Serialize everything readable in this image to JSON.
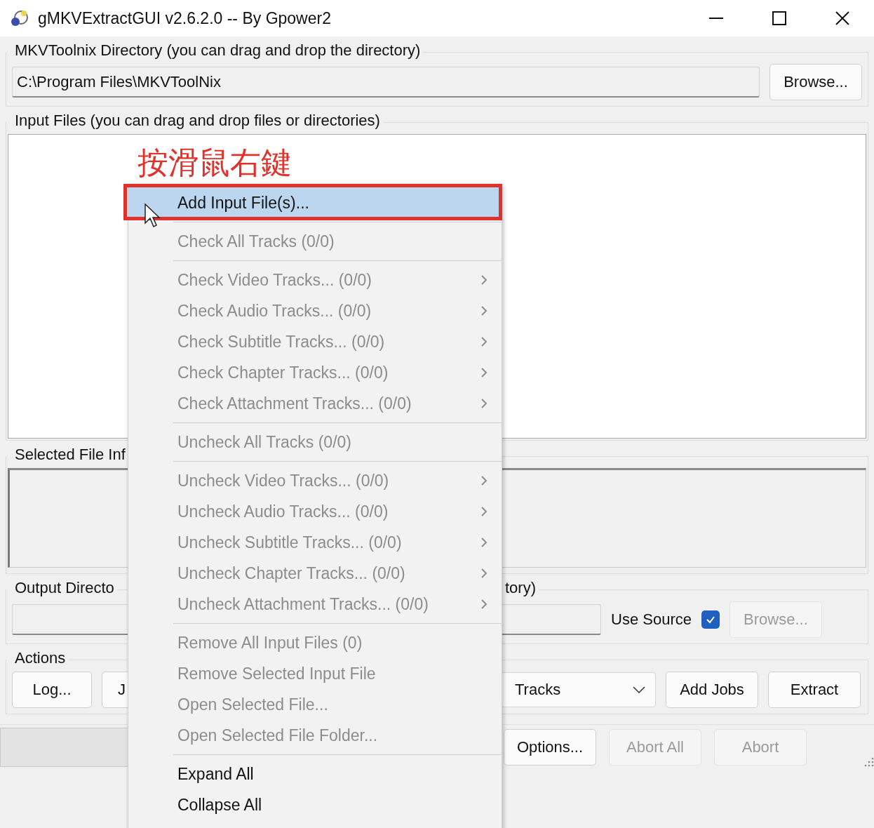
{
  "window": {
    "title": "gMKVExtractGUI v2.6.2.0 -- By Gpower2"
  },
  "mkvtoolnix_directory": {
    "label": "MKVToolnix Directory (you can drag and drop the directory)",
    "value": "C:\\Program Files\\MKVToolNix",
    "browse_button": "Browse..."
  },
  "input_files": {
    "label": "Input Files (you can drag and drop files or directories)"
  },
  "selected_file_info": {
    "label": "Selected File Inf"
  },
  "output_directory": {
    "label_left": "Output Directo",
    "label_right": "tory)",
    "use_source": {
      "label": "Use Source",
      "checked": true
    },
    "browse_button": {
      "label": "Browse...",
      "disabled": true
    }
  },
  "actions": {
    "label": "Actions",
    "log_button": "Log...",
    "jobs_button": "J",
    "mode_select": "Tracks",
    "add_jobs_button": "Add Jobs",
    "extract_button": "Extract"
  },
  "bottom_bar": {
    "options_button": {
      "label": "Options...",
      "disabled": false
    },
    "abort_all_button": {
      "label": "Abort All",
      "disabled": true
    },
    "abort_button": {
      "label": "Abort",
      "disabled": true
    }
  },
  "annotation": {
    "text": "按滑鼠右鍵"
  },
  "context_menu": {
    "groups": [
      [
        {
          "label": "Add Input File(s)...",
          "selected": true,
          "disabled": false,
          "submenu": false
        }
      ],
      [
        {
          "label": "Check All Tracks (0/0)",
          "selected": false,
          "disabled": true,
          "submenu": false
        }
      ],
      [
        {
          "label": "Check Video Tracks... (0/0)",
          "selected": false,
          "disabled": true,
          "submenu": true
        },
        {
          "label": "Check Audio Tracks... (0/0)",
          "selected": false,
          "disabled": true,
          "submenu": true
        },
        {
          "label": "Check Subtitle Tracks... (0/0)",
          "selected": false,
          "disabled": true,
          "submenu": true
        },
        {
          "label": "Check Chapter Tracks... (0/0)",
          "selected": false,
          "disabled": true,
          "submenu": true
        },
        {
          "label": "Check Attachment Tracks... (0/0)",
          "selected": false,
          "disabled": true,
          "submenu": true
        }
      ],
      [
        {
          "label": "Uncheck All Tracks (0/0)",
          "selected": false,
          "disabled": true,
          "submenu": false
        }
      ],
      [
        {
          "label": "Uncheck Video Tracks... (0/0)",
          "selected": false,
          "disabled": true,
          "submenu": true
        },
        {
          "label": "Uncheck Audio Tracks... (0/0)",
          "selected": false,
          "disabled": true,
          "submenu": true
        },
        {
          "label": "Uncheck Subtitle Tracks... (0/0)",
          "selected": false,
          "disabled": true,
          "submenu": true
        },
        {
          "label": "Uncheck Chapter Tracks... (0/0)",
          "selected": false,
          "disabled": true,
          "submenu": true
        },
        {
          "label": "Uncheck Attachment Tracks... (0/0)",
          "selected": false,
          "disabled": true,
          "submenu": true
        }
      ],
      [
        {
          "label": "Remove All Input Files (0)",
          "selected": false,
          "disabled": true,
          "submenu": false
        },
        {
          "label": "Remove Selected Input File",
          "selected": false,
          "disabled": true,
          "submenu": false
        },
        {
          "label": "Open Selected File...",
          "selected": false,
          "disabled": true,
          "submenu": false
        },
        {
          "label": "Open Selected File Folder...",
          "selected": false,
          "disabled": true,
          "submenu": false
        }
      ],
      [
        {
          "label": "Expand All",
          "selected": false,
          "disabled": false,
          "submenu": false
        },
        {
          "label": "Collapse All",
          "selected": false,
          "disabled": false,
          "submenu": false
        }
      ]
    ]
  }
}
